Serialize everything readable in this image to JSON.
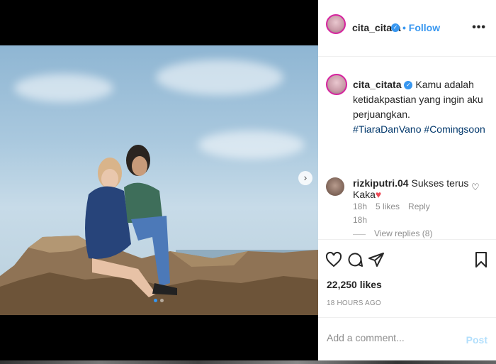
{
  "post": {
    "username": "cita_citata",
    "separator": "•",
    "follow_label": "Follow",
    "more_label": "•••",
    "caption": {
      "text": "Kamu adalah ketidakpastian yang ingin aku perjuangkan.",
      "hashtags": [
        "#TiaraDanVano",
        "#Comingsoon"
      ],
      "time": "18h"
    },
    "comments": [
      {
        "username": "rizkiputri.04",
        "text": "Sukses terus Kaka",
        "emoji": "♥",
        "time": "18h",
        "likes": "5 likes",
        "reply_label": "Reply",
        "view_replies": "View replies (8)"
      }
    ],
    "likes_count": "22,250 likes",
    "timestamp": "18 HOURS AGO",
    "add_comment_placeholder": "Add a comment...",
    "post_button": "Post",
    "carousel": {
      "total": 2,
      "current": 1
    },
    "icons": {
      "verified": "verified-badge-icon",
      "next": "chevron-right-icon",
      "like": "heart-icon",
      "comment": "comment-icon",
      "share": "share-icon",
      "save": "bookmark-icon"
    },
    "colors": {
      "accent": "#3897f0",
      "muted": "#8e8e8e",
      "heart": "#ed4956"
    }
  }
}
